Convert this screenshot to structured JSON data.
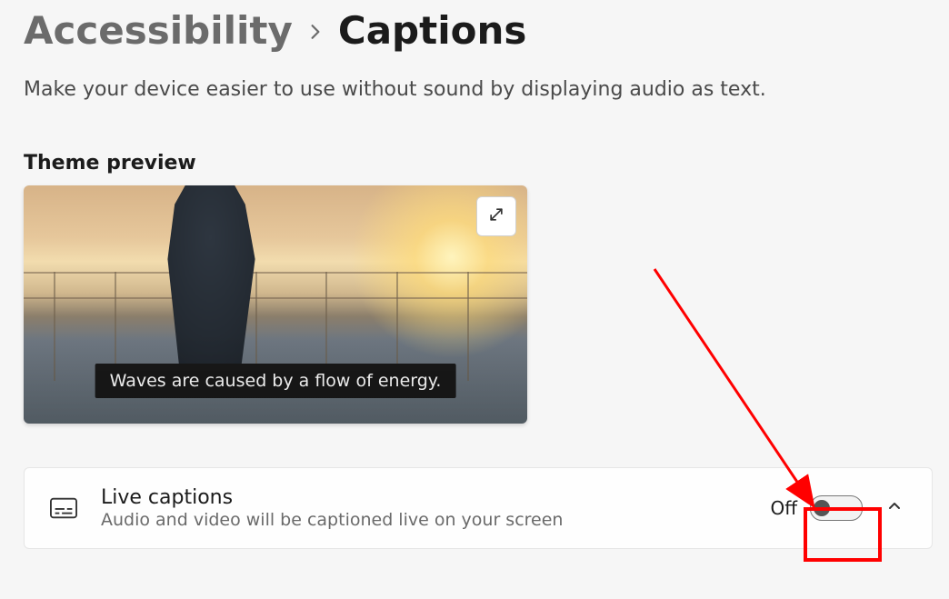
{
  "breadcrumb": {
    "parent": "Accessibility",
    "current": "Captions"
  },
  "subtitle": "Make your device easier to use without sound by displaying audio as text.",
  "theme_preview": {
    "heading": "Theme preview",
    "caption_text": "Waves are caused by a flow of energy."
  },
  "live_captions": {
    "title": "Live captions",
    "subtitle": "Audio and video will be captioned live on your screen",
    "state_label": "Off"
  },
  "icons": {
    "chevron_right": "chevron-right-icon",
    "expand": "expand-icon",
    "captions": "captions-icon",
    "chevron_up": "chevron-up-icon"
  },
  "annotation": {
    "highlight_color": "#ff0000"
  }
}
